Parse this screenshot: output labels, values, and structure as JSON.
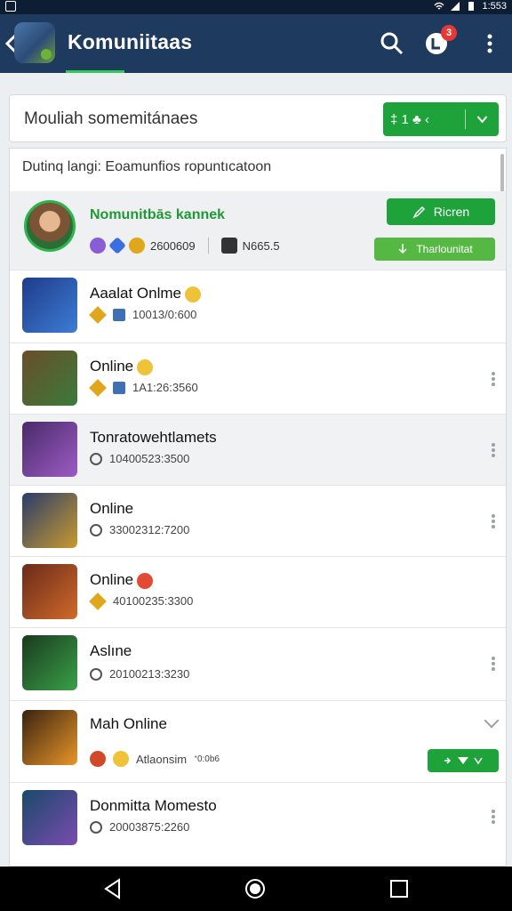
{
  "status_bar": {
    "time": "1:553"
  },
  "app_bar": {
    "title": "Komuniitaas",
    "notification_count": "3"
  },
  "search": {
    "placeholder": "Mouliah somemitánaes",
    "chip_label": "‡ 1 ♣ ‹"
  },
  "list_header": "Dutinq langi: Eoamunfios ropuntıcatoon",
  "featured": {
    "name": "Nomunitbās kannek",
    "meta_value": "2600609",
    "meta_value2": "N665.5",
    "button_primary": "Ricren",
    "button_secondary": "Tharlounitat"
  },
  "rows": [
    {
      "name": "Aaalat Onlme",
      "meta": "10013/0:600",
      "colors": [
        "#1f3b8a",
        "#3c7dd4"
      ]
    },
    {
      "name": "Online",
      "meta": "1A1:26:3560",
      "colors": [
        "#6a4d2a",
        "#3b7a3b"
      ]
    },
    {
      "name": "Tonratowehtlamets",
      "meta": "10400523:3500",
      "colors": [
        "#4a2a6a",
        "#9b5cc4"
      ]
    },
    {
      "name": "Online",
      "meta": "33002312:7200",
      "colors": [
        "#2a3c6a",
        "#c89a2e"
      ]
    },
    {
      "name": "Online",
      "meta": "40100235:3300",
      "colors": [
        "#6a2a1a",
        "#d06a2a"
      ]
    },
    {
      "name": "Aslıne",
      "meta": "20100213:3230",
      "colors": [
        "#1a3a1e",
        "#3aa048"
      ]
    },
    {
      "name": "Mah Online",
      "meta": "Atlaonsim",
      "meta_sup": "ᐩ0:0b6",
      "colors": [
        "#3a2210",
        "#e8962a"
      ]
    },
    {
      "name": "Donmitta Momesto",
      "meta": "20003875:2260",
      "colors": [
        "#1a4a6a",
        "#7a4bb0"
      ]
    }
  ],
  "icons": [
    "back-arrow-icon",
    "app-logo-icon",
    "search-icon",
    "notification-icon",
    "more-vert-icon",
    "edit-icon",
    "download-icon",
    "diamond-icon",
    "square-badge-icon",
    "heart-icon",
    "chevron-down-icon",
    "nav-back-icon",
    "nav-home-icon",
    "nav-recents-icon"
  ]
}
